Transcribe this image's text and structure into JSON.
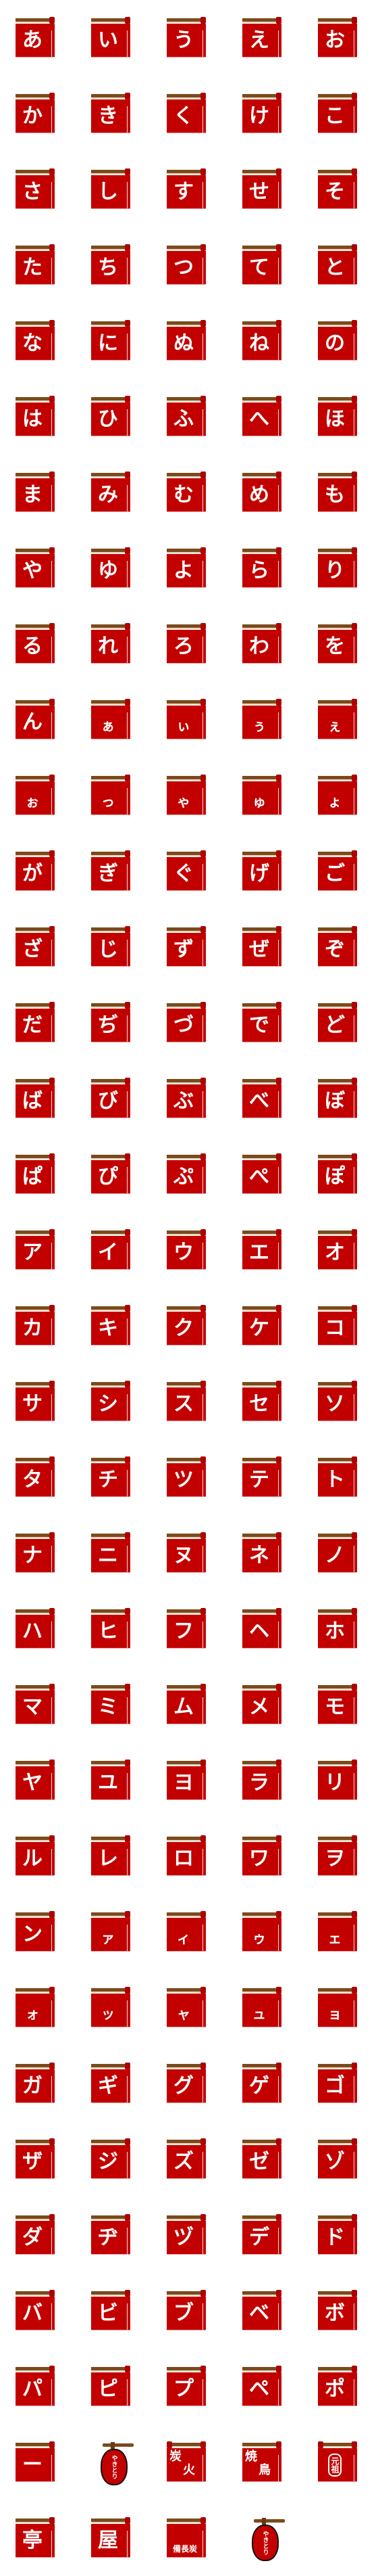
{
  "colors": {
    "banner": "#c20000",
    "rod": "#7b4a1c",
    "text": "#ffffff"
  },
  "tiles": [
    {
      "c": "あ"
    },
    {
      "c": "い"
    },
    {
      "c": "う"
    },
    {
      "c": "え"
    },
    {
      "c": "お"
    },
    {
      "c": "か"
    },
    {
      "c": "き"
    },
    {
      "c": "く"
    },
    {
      "c": "け"
    },
    {
      "c": "こ"
    },
    {
      "c": "さ"
    },
    {
      "c": "し"
    },
    {
      "c": "す"
    },
    {
      "c": "せ"
    },
    {
      "c": "そ"
    },
    {
      "c": "た"
    },
    {
      "c": "ち"
    },
    {
      "c": "つ"
    },
    {
      "c": "て"
    },
    {
      "c": "と"
    },
    {
      "c": "な"
    },
    {
      "c": "に"
    },
    {
      "c": "ぬ"
    },
    {
      "c": "ね"
    },
    {
      "c": "の"
    },
    {
      "c": "は"
    },
    {
      "c": "ひ"
    },
    {
      "c": "ふ"
    },
    {
      "c": "へ"
    },
    {
      "c": "ほ"
    },
    {
      "c": "ま"
    },
    {
      "c": "み"
    },
    {
      "c": "む"
    },
    {
      "c": "め"
    },
    {
      "c": "も"
    },
    {
      "c": "や"
    },
    {
      "c": "ゆ"
    },
    {
      "c": "よ"
    },
    {
      "c": "ら"
    },
    {
      "c": "り"
    },
    {
      "c": "る"
    },
    {
      "c": "れ"
    },
    {
      "c": "ろ"
    },
    {
      "c": "わ"
    },
    {
      "c": "を"
    },
    {
      "c": "ん"
    },
    {
      "c": "ぁ",
      "small": true
    },
    {
      "c": "ぃ",
      "small": true
    },
    {
      "c": "ぅ",
      "small": true
    },
    {
      "c": "ぇ",
      "small": true
    },
    {
      "c": "ぉ",
      "small": true
    },
    {
      "c": "っ",
      "small": true
    },
    {
      "c": "ゃ",
      "small": true
    },
    {
      "c": "ゅ",
      "small": true
    },
    {
      "c": "ょ",
      "small": true
    },
    {
      "c": "が"
    },
    {
      "c": "ぎ"
    },
    {
      "c": "ぐ"
    },
    {
      "c": "げ"
    },
    {
      "c": "ご"
    },
    {
      "c": "ざ"
    },
    {
      "c": "じ"
    },
    {
      "c": "ず"
    },
    {
      "c": "ぜ"
    },
    {
      "c": "ぞ"
    },
    {
      "c": "だ"
    },
    {
      "c": "ぢ"
    },
    {
      "c": "づ"
    },
    {
      "c": "で"
    },
    {
      "c": "ど"
    },
    {
      "c": "ば"
    },
    {
      "c": "び"
    },
    {
      "c": "ぶ"
    },
    {
      "c": "べ"
    },
    {
      "c": "ぼ"
    },
    {
      "c": "ぱ"
    },
    {
      "c": "ぴ"
    },
    {
      "c": "ぷ"
    },
    {
      "c": "ぺ"
    },
    {
      "c": "ぽ"
    },
    {
      "c": "ア"
    },
    {
      "c": "イ"
    },
    {
      "c": "ウ"
    },
    {
      "c": "エ"
    },
    {
      "c": "オ"
    },
    {
      "c": "カ"
    },
    {
      "c": "キ"
    },
    {
      "c": "ク"
    },
    {
      "c": "ケ"
    },
    {
      "c": "コ"
    },
    {
      "c": "サ"
    },
    {
      "c": "シ"
    },
    {
      "c": "ス"
    },
    {
      "c": "セ"
    },
    {
      "c": "ソ"
    },
    {
      "c": "タ"
    },
    {
      "c": "チ"
    },
    {
      "c": "ツ"
    },
    {
      "c": "テ"
    },
    {
      "c": "ト"
    },
    {
      "c": "ナ"
    },
    {
      "c": "ニ"
    },
    {
      "c": "ヌ"
    },
    {
      "c": "ネ"
    },
    {
      "c": "ノ"
    },
    {
      "c": "ハ"
    },
    {
      "c": "ヒ"
    },
    {
      "c": "フ"
    },
    {
      "c": "ヘ"
    },
    {
      "c": "ホ"
    },
    {
      "c": "マ"
    },
    {
      "c": "ミ"
    },
    {
      "c": "ム"
    },
    {
      "c": "メ"
    },
    {
      "c": "モ"
    },
    {
      "c": "ヤ"
    },
    {
      "c": "ユ"
    },
    {
      "c": "ヨ"
    },
    {
      "c": "ラ"
    },
    {
      "c": "リ"
    },
    {
      "c": "ル"
    },
    {
      "c": "レ"
    },
    {
      "c": "ロ"
    },
    {
      "c": "ワ"
    },
    {
      "c": "ヲ"
    },
    {
      "c": "ン"
    },
    {
      "c": "ァ",
      "small": true
    },
    {
      "c": "ィ",
      "small": true
    },
    {
      "c": "ゥ",
      "small": true
    },
    {
      "c": "ェ",
      "small": true
    },
    {
      "c": "ォ",
      "small": true
    },
    {
      "c": "ッ",
      "small": true
    },
    {
      "c": "ャ",
      "small": true
    },
    {
      "c": "ュ",
      "small": true
    },
    {
      "c": "ョ",
      "small": true
    },
    {
      "c": "ガ"
    },
    {
      "c": "ギ"
    },
    {
      "c": "グ"
    },
    {
      "c": "ゲ"
    },
    {
      "c": "ゴ"
    },
    {
      "c": "ザ"
    },
    {
      "c": "ジ"
    },
    {
      "c": "ズ"
    },
    {
      "c": "ゼ"
    },
    {
      "c": "ゾ"
    },
    {
      "c": "ダ"
    },
    {
      "c": "ヂ"
    },
    {
      "c": "ヅ"
    },
    {
      "c": "デ"
    },
    {
      "c": "ド"
    },
    {
      "c": "バ"
    },
    {
      "c": "ビ"
    },
    {
      "c": "ブ"
    },
    {
      "c": "ベ"
    },
    {
      "c": "ボ"
    },
    {
      "c": "パ"
    },
    {
      "c": "ピ"
    },
    {
      "c": "プ"
    },
    {
      "c": "ペ"
    },
    {
      "c": "ポ"
    },
    {
      "c": "ー"
    },
    {
      "lantern": "やきとり"
    },
    {
      "two": [
        "炭",
        "火"
      ],
      "knobs": 2
    },
    {
      "two": [
        "焼",
        "鳥"
      ]
    },
    {
      "stamp": "元祖",
      "knobs": 2
    },
    {
      "c": "亭"
    },
    {
      "c": "屋"
    },
    {
      "tiny": "備長炭"
    },
    {
      "lantern": "やきとり"
    }
  ]
}
